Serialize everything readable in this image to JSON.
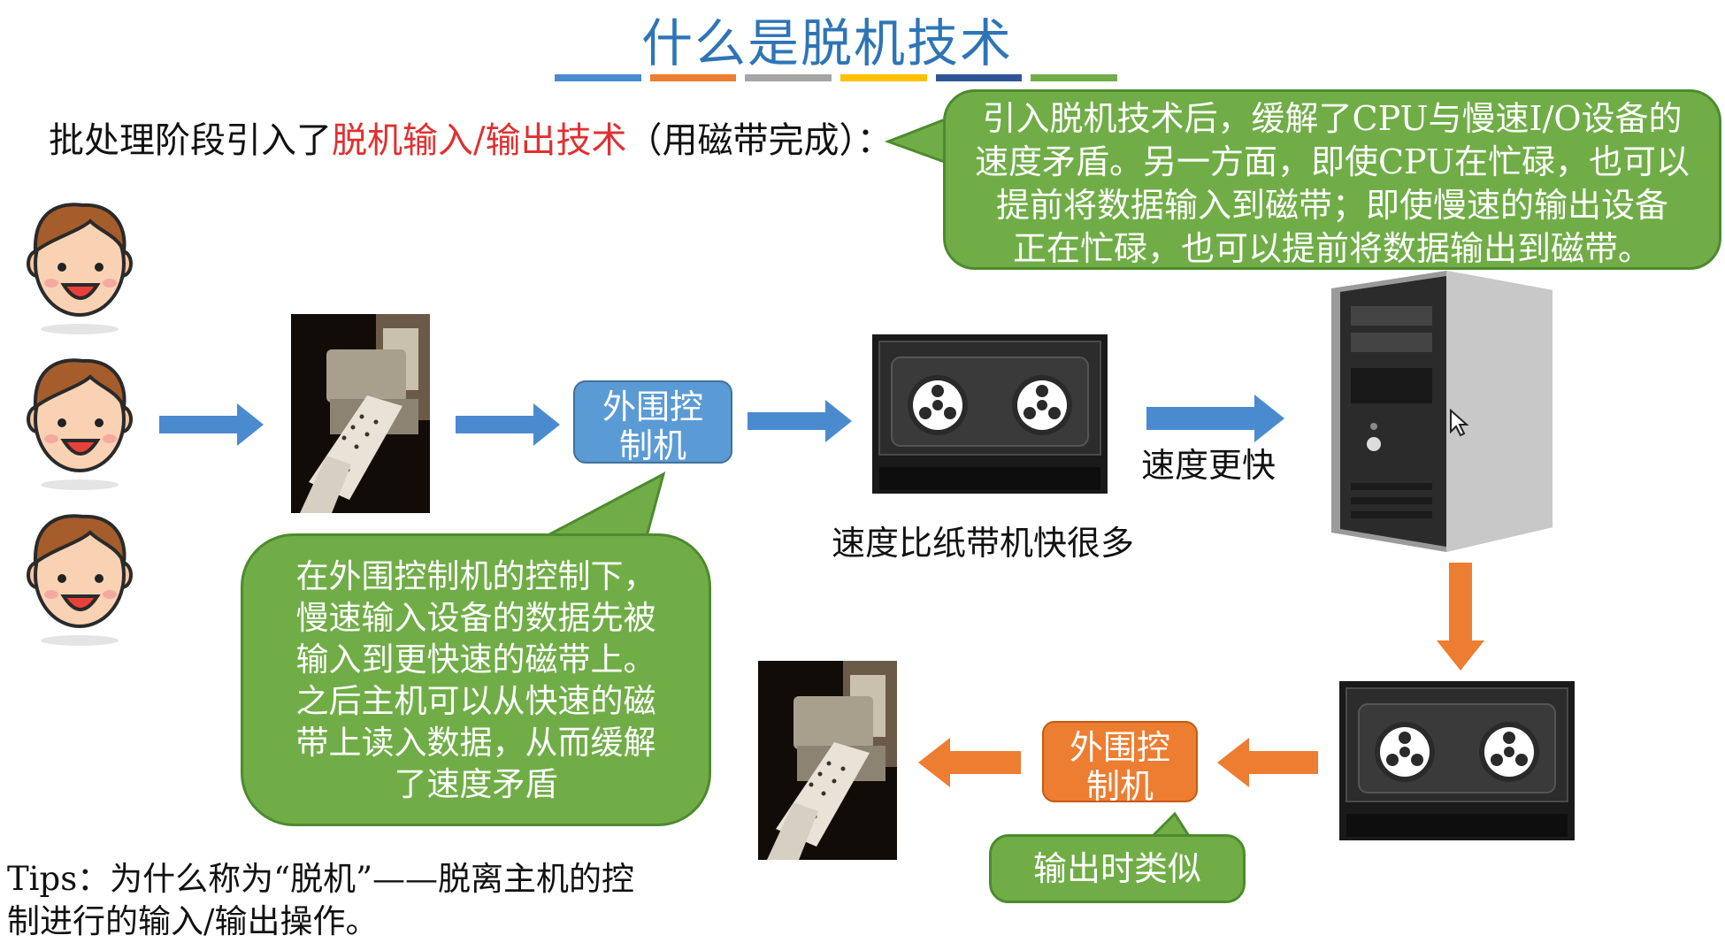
{
  "title": "什么是脱机技术",
  "title_bar_colors": [
    "#4a8bd0",
    "#ed7d31",
    "#a5a5a5",
    "#ffc000",
    "#2f5597",
    "#70ad47"
  ],
  "intro": {
    "prefix": "批处理阶段引入了",
    "highlight": "脱机输入/输出技术",
    "suffix": "（用磁带完成）："
  },
  "bubble_top": [
    "引入脱机技术后，缓解了CPU与慢速I/O设备的",
    "速度矛盾。另一方面，即使CPU在忙碌，也可以",
    "提前将数据输入到磁带；即使慢速的输出设备",
    "正在忙碌，也可以提前将数据输出到磁带。"
  ],
  "ctrl_top": [
    "外围控",
    "制机"
  ],
  "ctrl_bottom": [
    "外围控",
    "制机"
  ],
  "tape_label": "速度比纸带机快很多",
  "fast_label": "速度更快",
  "bubble_mid": [
    "在外围控制机的控制下，",
    "慢速输入设备的数据先被",
    "输入到更快速的磁带上。",
    "之后主机可以从快速的磁",
    "带上读入数据，从而缓解",
    "了速度矛盾"
  ],
  "bubble_out": "输出时类似",
  "tips": [
    "Tips：为什么称为“脱机”——脱离主机的控",
    "制进行的输入/输出操作。"
  ],
  "colors": {
    "blue": "#4a8bd0",
    "orange": "#ed7d31",
    "green": "#70ad47",
    "red": "#e0302f"
  },
  "icons": [
    "user-face-icon",
    "paper-tape-machine-icon",
    "tape-drive-icon",
    "computer-tower-icon",
    "mouse-cursor-icon",
    "arrow-right-icon",
    "arrow-left-icon",
    "arrow-down-icon"
  ]
}
